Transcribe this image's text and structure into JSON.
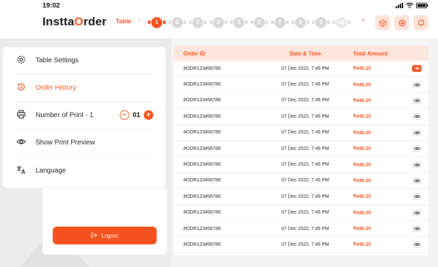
{
  "status_bar": {
    "time": "19:02"
  },
  "header": {
    "logo_prefix": "Instta",
    "logo_o": "O",
    "logo_suffix": "rder",
    "table_label": "Table",
    "tables": [
      "1",
      "2",
      "3",
      "4",
      "5",
      "6",
      "7",
      "8",
      "9",
      "10"
    ],
    "active_table": "1"
  },
  "menu": {
    "items": [
      {
        "label": "Table Settings",
        "icon": "gear-icon"
      },
      {
        "label": "Order History",
        "icon": "history-icon"
      },
      {
        "label": "Number of Print - 1",
        "icon": "printer-icon"
      },
      {
        "label": "Show Print Preview",
        "icon": "eye-icon"
      },
      {
        "label": "Language",
        "icon": "translate-icon"
      }
    ],
    "active_item": "Order History",
    "print_count": "01"
  },
  "logout": {
    "label": "Logout"
  },
  "orders": {
    "columns": [
      "Order ID",
      "Date & Time",
      "Total Amount"
    ],
    "rows": [
      {
        "id": "#ODR123456789",
        "datetime": "07 Dec 2022, 7:45 PM",
        "amount": "₹440.25"
      },
      {
        "id": "#ODR123456789",
        "datetime": "07 Dec 2022, 7:45 PM",
        "amount": "₹440.25"
      },
      {
        "id": "#ODR123456789",
        "datetime": "07 Dec 2022, 7:45 PM",
        "amount": "₹440.25"
      },
      {
        "id": "#ODR123456789",
        "datetime": "07 Dec 2022, 7:45 PM",
        "amount": "₹440.25"
      },
      {
        "id": "#ODR123456789",
        "datetime": "07 Dec 2022, 7:45 PM",
        "amount": "₹440.25"
      },
      {
        "id": "#ODR123456789",
        "datetime": "07 Dec 2022, 7:45 PM",
        "amount": "₹440.25"
      },
      {
        "id": "#ODR123456789",
        "datetime": "07 Dec 2022, 7:45 PM",
        "amount": "₹440.25"
      },
      {
        "id": "#ODR123456789",
        "datetime": "07 Dec 2022, 7:45 PM",
        "amount": "₹440.25"
      },
      {
        "id": "#ODR123456789",
        "datetime": "07 Dec 2022, 7:45 PM",
        "amount": "₹440.25"
      },
      {
        "id": "#ODR123456789",
        "datetime": "07 Dec 2022, 7:45 PM",
        "amount": "₹440.25"
      },
      {
        "id": "#ODR123456789",
        "datetime": "07 Dec 2022, 7:45 PM",
        "amount": "₹440.25"
      },
      {
        "id": "#ODR123456789",
        "datetime": "07 Dec 2022, 7:45 PM",
        "amount": "₹440.25"
      }
    ]
  },
  "colors": {
    "accent": "#f4511e",
    "accent_soft": "#fde6dd"
  }
}
